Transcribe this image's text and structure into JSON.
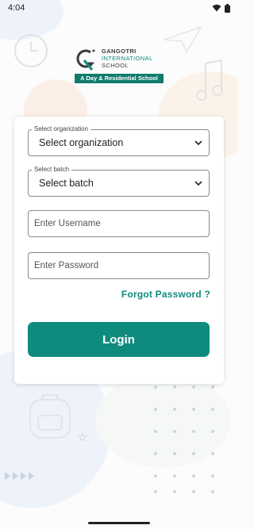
{
  "statusbar": {
    "time": "4:04",
    "wifi_icon": "wifi-icon",
    "battery_icon": "battery-icon"
  },
  "logo": {
    "line1": "GANGOTRI",
    "line2": "INTERNATIONAL",
    "line3": "SCHOOL",
    "tagline": "A Day & Residential School"
  },
  "form": {
    "organization": {
      "label": "Select organization",
      "value": "Select organization"
    },
    "batch": {
      "label": "Select batch",
      "value": "Select batch"
    },
    "username": {
      "placeholder": "Enter Username"
    },
    "password": {
      "placeholder": "Enter Password"
    },
    "forgot_label": "Forgot Password ?",
    "login_label": "Login"
  },
  "colors": {
    "accent": "#0f8b7d",
    "tagline_bg": "#117a6d"
  }
}
